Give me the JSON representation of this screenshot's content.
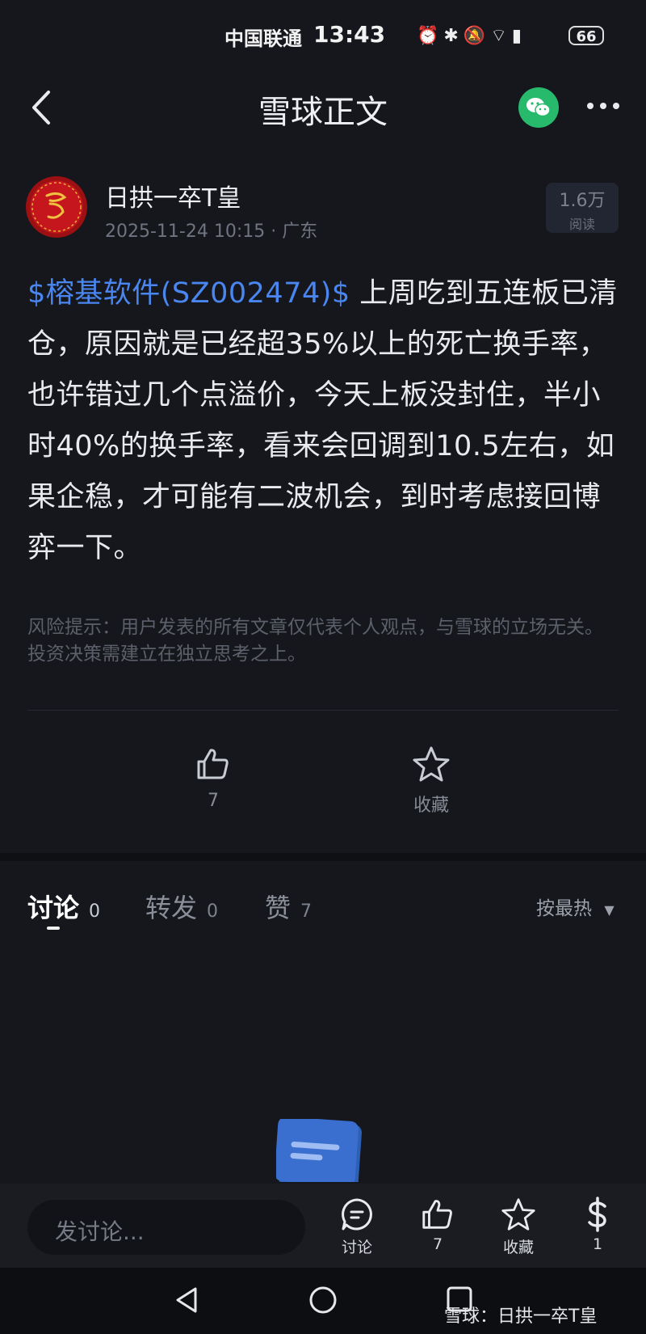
{
  "status_bar": {
    "carrier": "中国联通",
    "time": "13:43",
    "battery": "66"
  },
  "header": {
    "title": "雪球正文",
    "share_icon": "wechat-icon",
    "more_icon": "more-icon"
  },
  "post": {
    "author": "日拱一卒T皇",
    "datetime": "2025-11-24 10:15",
    "location": "广东",
    "reads": "1.6万",
    "reads_label": "阅读",
    "stock_tag": "$榕基软件(SZ002474)$",
    "body": " 上周吃到五连板已清仓，原因就是已经超35%以上的死亡换手率，也许错过几个点溢价，今天上板没封住，半小时40%的换手率，看来会回调到10.5左右，如果企稳，才可能有二波机会，到时考虑接回博弈一下。",
    "risk_notice": "风险提示：用户发表的所有文章仅代表个人观点，与雪球的立场无关。投资决策需建立在独立思考之上。"
  },
  "actions": {
    "like_count": "7",
    "favorite_label": "收藏"
  },
  "tabs": [
    {
      "label": "讨论",
      "count": "0"
    },
    {
      "label": "转发",
      "count": "0"
    },
    {
      "label": "赞",
      "count": "7"
    }
  ],
  "sort_label": "按最热",
  "bottom_bar": {
    "input_placeholder": "发讨论...",
    "discuss_label": "讨论",
    "like_count": "7",
    "favorite_label": "收藏",
    "reward_count": "1"
  },
  "watermark": "雪球：日拱一卒T皇",
  "colors": {
    "link": "#4a86f0",
    "wechat": "#27ba6d",
    "background": "#15171c"
  }
}
